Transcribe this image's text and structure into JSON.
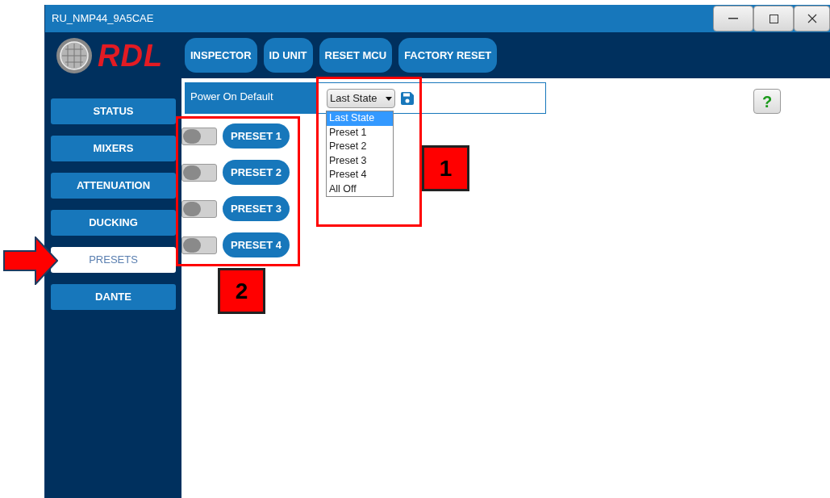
{
  "window": {
    "title": "RU_NMP44_9A5CAE"
  },
  "logo": {
    "text": "RDL"
  },
  "toolbar": [
    "INSPECTOR",
    "ID UNIT",
    "RESET MCU",
    "FACTORY RESET"
  ],
  "sidebar": {
    "items": [
      {
        "label": "STATUS",
        "selected": false
      },
      {
        "label": "MIXERS",
        "selected": false
      },
      {
        "label": "ATTENUATION",
        "selected": false
      },
      {
        "label": "DUCKING",
        "selected": false
      },
      {
        "label": "PRESETS",
        "selected": true
      },
      {
        "label": "DANTE",
        "selected": false
      }
    ]
  },
  "power_on_default": {
    "label": "Power On Default",
    "value": "Last State",
    "expanded": true,
    "options": [
      {
        "label": "Last State",
        "selected": true
      },
      {
        "label": "Preset 1",
        "selected": false
      },
      {
        "label": "Preset 2",
        "selected": false
      },
      {
        "label": "Preset 3",
        "selected": false
      },
      {
        "label": "Preset 4",
        "selected": false
      },
      {
        "label": "All Off",
        "selected": false
      }
    ]
  },
  "presets": [
    {
      "label": "PRESET 1",
      "on": false
    },
    {
      "label": "PRESET 2",
      "on": false
    },
    {
      "label": "PRESET 3",
      "on": false
    },
    {
      "label": "PRESET 4",
      "on": false
    }
  ],
  "help_button": {
    "label": "?"
  },
  "annotations": [
    {
      "number": "1"
    },
    {
      "number": "2"
    }
  ]
}
